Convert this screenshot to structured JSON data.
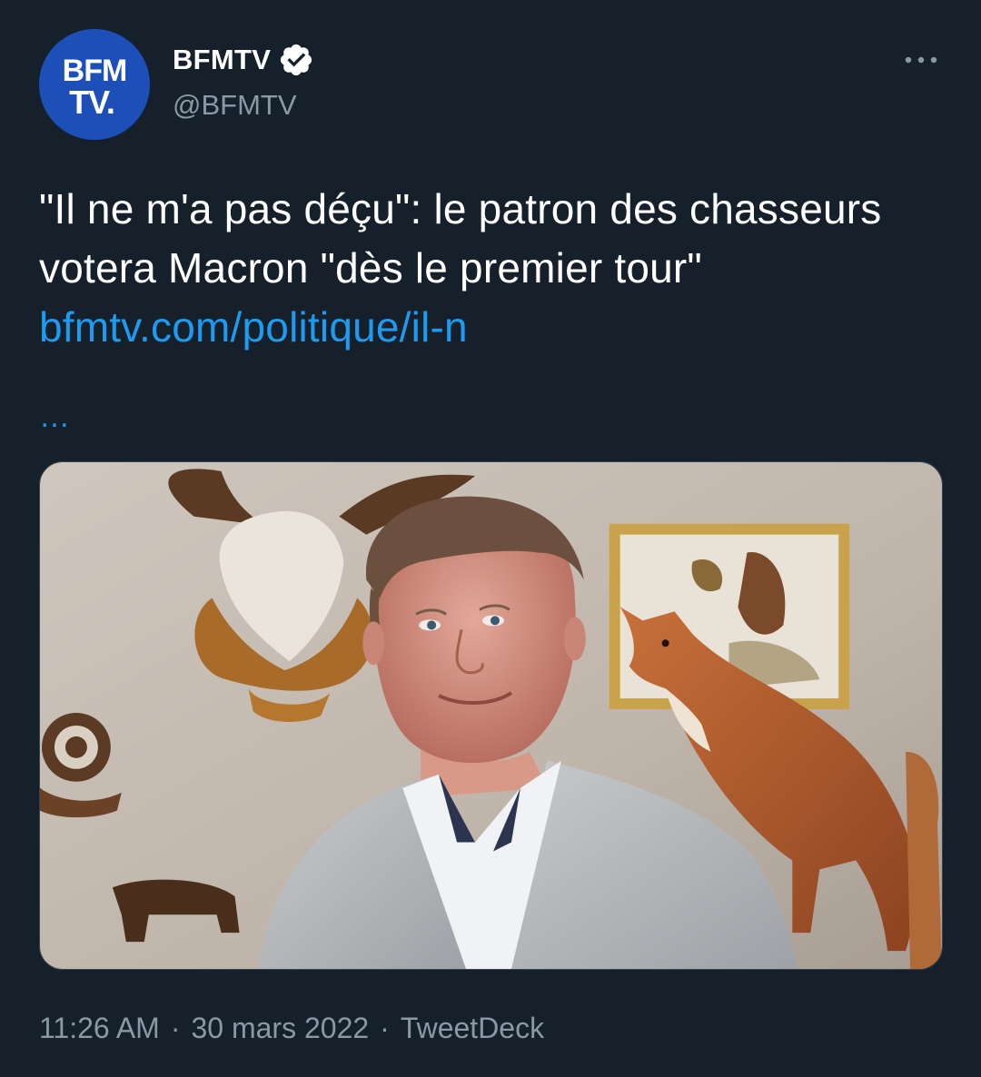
{
  "author": {
    "display_name": "BFMTV",
    "handle": "@BFMTV",
    "verified": true,
    "avatar_logo_text": [
      "BFM",
      "TV."
    ]
  },
  "tweet": {
    "text": "\"Il ne m'a pas déçu\": le patron des chasseurs votera Macron \"dès le premier tour\" ",
    "link_text": "bfmtv.com/politique/il-n",
    "link_ellipsis": "…"
  },
  "footer": {
    "time": "11:26 AM",
    "separator": "·",
    "date": "30 mars 2022",
    "source": "TweetDeck"
  },
  "icons": {
    "more": "more-horizontal-icon",
    "verified": "verified-badge-icon"
  },
  "colors": {
    "background": "#15202b",
    "link": "#1d9bf0",
    "secondary_text": "#8b98a5",
    "avatar_blue": "#1d4fb8"
  }
}
